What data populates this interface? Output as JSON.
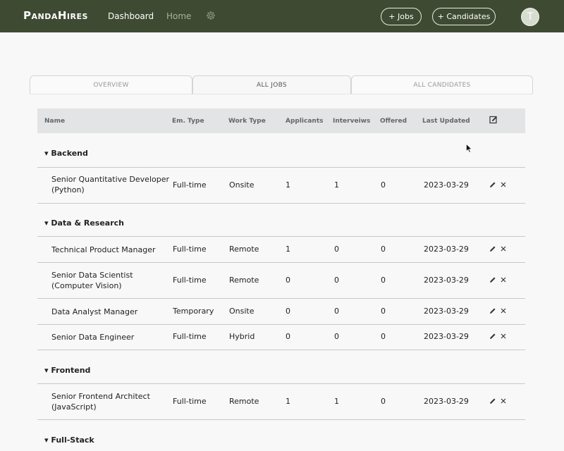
{
  "header": {
    "brand": "PandaHires",
    "nav": {
      "dashboard": "Dashboard",
      "home": "Home"
    },
    "buttons": {
      "jobs": "+ Jobs",
      "candidates": "+ Candidates"
    },
    "avatar_initial": "T",
    "icons": {
      "settings": "gear-icon"
    }
  },
  "tabs": [
    {
      "label": "OVERVIEW"
    },
    {
      "label": "ALL JOBS"
    },
    {
      "label": "ALL CANDIDATES"
    }
  ],
  "active_tab": "ALL JOBS",
  "table": {
    "columns": {
      "name": "Name",
      "emp_type": "Em. Type",
      "work_type": "Work Type",
      "applicants": "Applicants",
      "interviews": "Interveiws",
      "offered": "Offered",
      "last_updated": "Last Updated"
    },
    "groups": [
      {
        "name": "Backend",
        "rows": [
          {
            "name": "Senior Quantitative Developer (Python)",
            "emp": "Full-time",
            "work": "Onsite",
            "applicants": "1",
            "interviews": "1",
            "offered": "0",
            "date": "2023-03-29"
          }
        ]
      },
      {
        "name": "Data & Research",
        "rows": [
          {
            "name": "Technical Product Manager",
            "emp": "Full-time",
            "work": "Remote",
            "applicants": "1",
            "interviews": "0",
            "offered": "0",
            "date": "2023-03-29"
          },
          {
            "name": "Senior Data Scientist  (Computer Vision)",
            "emp": "Full-time",
            "work": "Remote",
            "applicants": "0",
            "interviews": "0",
            "offered": "0",
            "date": "2023-03-29"
          },
          {
            "name": "Data Analyst Manager",
            "emp": "Temporary",
            "work": "Onsite",
            "applicants": "0",
            "interviews": "0",
            "offered": "0",
            "date": "2023-03-29"
          },
          {
            "name": "Senior Data Engineer",
            "emp": "Full-time",
            "work": "Hybrid",
            "applicants": "0",
            "interviews": "0",
            "offered": "0",
            "date": "2023-03-29"
          }
        ]
      },
      {
        "name": "Frontend",
        "rows": [
          {
            "name": "Senior Frontend Architect (JavaScript)",
            "emp": "Full-time",
            "work": "Remote",
            "applicants": "1",
            "interviews": "1",
            "offered": "0",
            "date": "2023-03-29"
          }
        ]
      },
      {
        "name": "Full-Stack",
        "rows": []
      }
    ],
    "group_caret": "▾"
  },
  "colors": {
    "header_bg": "#3f4a32",
    "header_text": "#ffffff",
    "table_header_bg": "#e3e4e6"
  }
}
